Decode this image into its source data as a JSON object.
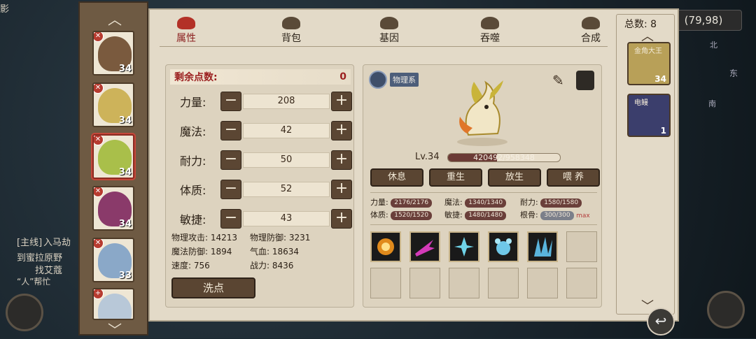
{
  "background": {
    "coord": "(79,98)",
    "quest_tag": "[主线]",
    "quest_line1": "入马劫",
    "quest_line2": "到蜜拉原野",
    "quest_line3": "找艾蔻",
    "quest_line4": "“人”帮忙",
    "compass_east": "东",
    "compass_north": "北",
    "compass_south": "南"
  },
  "tabs": [
    {
      "label": "属性",
      "icon": "flame-icon",
      "active": true
    },
    {
      "label": "背包",
      "icon": "bag-icon",
      "active": false
    },
    {
      "label": "基因",
      "icon": "eye-icon",
      "active": false
    },
    {
      "label": "吞噬",
      "icon": "devour-icon",
      "active": false
    },
    {
      "label": "合成",
      "icon": "synth-icon",
      "active": false
    }
  ],
  "attributes": {
    "points_label": "剩余点数:",
    "points_value": "0",
    "rows": [
      {
        "label": "力量:",
        "value": "208"
      },
      {
        "label": "魔法:",
        "value": "42"
      },
      {
        "label": "耐力:",
        "value": "50"
      },
      {
        "label": "体质:",
        "value": "52"
      },
      {
        "label": "敏捷:",
        "value": "43"
      }
    ],
    "stats": [
      {
        "text": "物理攻击: 14213"
      },
      {
        "text": "物理防御: 3231"
      },
      {
        "text": "魔法防御: 1894"
      },
      {
        "text": "气血: 18634"
      },
      {
        "text": "速度: 756"
      },
      {
        "text": "战力: 8436"
      }
    ],
    "reset_label": "洗点"
  },
  "pet": {
    "type_label": "物理系",
    "level": "Lv.34",
    "exp_text": "420492/958348",
    "exp_fraction": 0.439,
    "actions": [
      "休息",
      "重生",
      "放生",
      "喂 养"
    ],
    "potentials": [
      {
        "label": "力量:",
        "value": "2176/2176"
      },
      {
        "label": "魔法:",
        "value": "1340/1340"
      },
      {
        "label": "耐力:",
        "value": "1580/1580"
      },
      {
        "label": "体质:",
        "value": "1520/1520"
      },
      {
        "label": "敏捷:",
        "value": "1480/1480"
      },
      {
        "label": "根骨:",
        "value": "300/300",
        "suffix": "max"
      }
    ],
    "skills": [
      "sun-skill-icon",
      "slash-skill-icon",
      "ice-skill-icon",
      "frost-skill-icon",
      "shard-skill-icon",
      "",
      "",
      "",
      "",
      "",
      "",
      ""
    ]
  },
  "roster": {
    "total_label": "总数: 8",
    "items": [
      {
        "name": "金角大王",
        "level": "34",
        "color": "#c9b05a"
      },
      {
        "name": "电鳗",
        "level": "1",
        "color": "#3b3e6c"
      }
    ]
  },
  "portraits": [
    {
      "level": "34",
      "color": "#7a5a3e"
    },
    {
      "level": "34",
      "color": "#cdb35a"
    },
    {
      "level": "34",
      "color": "#a9bf4a"
    },
    {
      "level": "34",
      "color": "#8a3a6a"
    },
    {
      "level": "33",
      "color": "#8aa8c8"
    },
    {
      "level": "",
      "color": "#b8c8d8"
    }
  ]
}
